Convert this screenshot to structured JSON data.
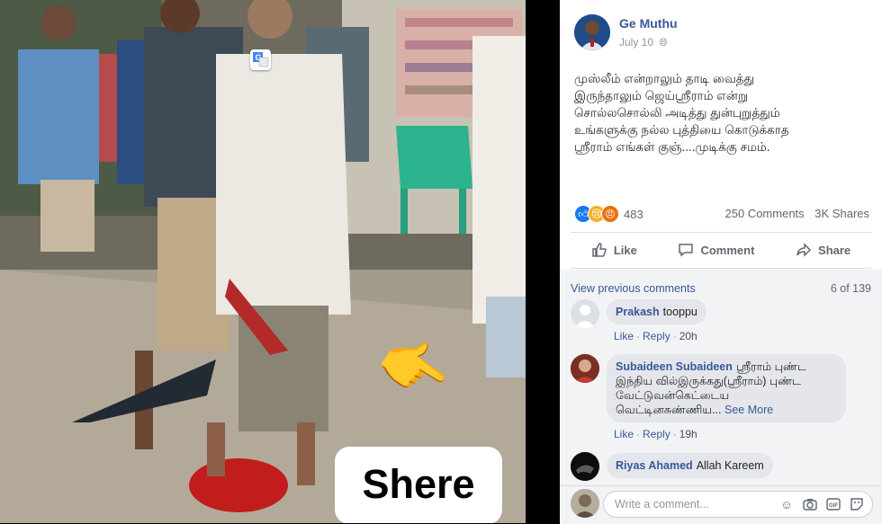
{
  "photo": {
    "overlay_text": "Shere",
    "translate_badge_icon": "google-translate-icon",
    "hand_emoji": "👉"
  },
  "post": {
    "author": "Ge Muthu",
    "date": "July 10",
    "privacy_icon": "globe-icon",
    "text": "முஸ்லீம் என்றாலும் தாடி வைத்து\nஇருந்தாலும் ஜெய்ஸ்ரீராம் என்று\nசொல்லசொல்லி அடித்து துன்புறுத்தும்\nஉங்களுக்கு நல்ல புத்தியை கொடுக்காத\nஸ்ரீராம் எங்கள் குஞ்....முடிக்கு சமம்.",
    "reaction_count": "483",
    "comments_count": "250 Comments",
    "shares_count": "3K Shares"
  },
  "actions": {
    "like": "Like",
    "comment": "Comment",
    "share": "Share"
  },
  "comments_section": {
    "view_previous": "View previous comments",
    "page_count": "6 of 139",
    "comments": [
      {
        "name": "Prakash",
        "text": "tooppu",
        "like": "Like",
        "reply": "Reply",
        "time": "20h"
      },
      {
        "name": "Subaideen Subaideen",
        "text": "ஸ்ரீராம் புண்ட இந்திய வில்இருக்கது(ஸ்ரீராம்) புண்ட வேட்டுவன்கெட்டைய வெட்டினசுண்ணிய...",
        "see_more": "See More",
        "like": "Like",
        "reply": "Reply",
        "time": "19h"
      },
      {
        "name": "Riyas Ahamed",
        "text": "Allah Kareem"
      }
    ],
    "write_placeholder": "Write a comment..."
  },
  "colors": {
    "link": "#385898",
    "like_blue": "#1877f2",
    "sad_yellow": "#f7b125",
    "angry_orange": "#e9710f"
  }
}
